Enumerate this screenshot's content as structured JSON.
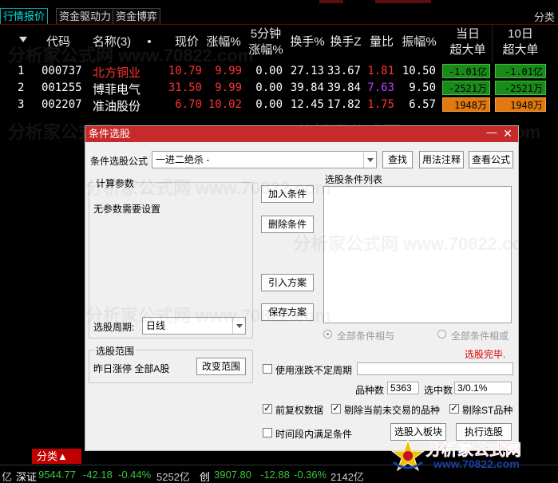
{
  "tabs": [
    "行情报价",
    "资金驱动力",
    "资金博弈"
  ],
  "top_right": "分类",
  "columns": {
    "code": "代码",
    "name": "名称(3)",
    "dot": "•",
    "price": "现价",
    "chg": "涨幅%",
    "chg5_1": "5分钟",
    "chg5_2": "涨幅%",
    "turnover": "换手%",
    "turnoverz": "换手Z",
    "volratio": "量比",
    "amplitude": "振幅%",
    "today1": "当日",
    "today2": "超大单",
    "ten1": "10日",
    "ten2": "超大单"
  },
  "rows": [
    {
      "idx": "1",
      "code": "000737",
      "name": "北方铜业",
      "price": "10.79",
      "chg": "9.99",
      "chg5": "0.00",
      "turnover": "27.13",
      "turnoverz": "33.67",
      "volratio": "1.81",
      "amplitude": "10.50",
      "today": "-1.01亿",
      "ten": "-1.01亿"
    },
    {
      "idx": "2",
      "code": "001255",
      "name": "博菲电气",
      "price": "31.50",
      "chg": "9.99",
      "chg5": "0.00",
      "turnover": "39.84",
      "turnoverz": "39.84",
      "volratio": "7.63",
      "amplitude": "9.50",
      "today": "-2521万",
      "ten": "-2521万"
    },
    {
      "idx": "3",
      "code": "002207",
      "name": "准油股份",
      "price": "6.70",
      "chg": "10.02",
      "chg5": "0.00",
      "turnover": "12.45",
      "turnoverz": "17.82",
      "volratio": "1.75",
      "amplitude": "6.57",
      "today": "1948万",
      "ten": "1948万"
    }
  ],
  "colors": {
    "red": "#ff3232",
    "green_box": "#1a8b1a",
    "orange_box": "#e07a10",
    "purple": "#c040ff",
    "title_bar": "#c72a2a"
  },
  "dialog": {
    "title": "条件选股",
    "formula_label": "条件选股公式",
    "formula_value": "一进二绝杀   -",
    "find_btn": "查找",
    "usage_btn": "用法注释",
    "view_btn": "查看公式",
    "calc_group": "计算参数",
    "no_params": "无参数需要设置",
    "add_btn": "加入条件",
    "del_btn": "删除条件",
    "import_btn": "引入方案",
    "save_btn": "保存方案",
    "list_label": "选股条件列表",
    "period_label": "选股周期:",
    "period_value": "日线",
    "radio_and": "全部条件相与",
    "radio_or": "全部条件相或",
    "done_msg": "选股完毕.",
    "range_group": "选股范围",
    "range_value": "昨日涨停 全部A股",
    "change_range_btn": "改变范围",
    "uncertain_label": "使用涨跌不定周期",
    "count_label": "品种数",
    "count_value": "5363",
    "selected_label": "选中数",
    "selected_value": "3/0.1%",
    "opt_prefq": "前复权数据",
    "opt_exclude_untraded": "剔除当前未交易的品种",
    "opt_exclude_st": "剔除ST品种",
    "opt_period_match": "时间段内满足条件",
    "to_block_btn": "选股入板块",
    "run_btn": "执行选股"
  },
  "bottom": {
    "fenlei": "分类▲",
    "left_frag": "亿",
    "index_name": "深证",
    "index_value": "9544.77",
    "index_chg": "-42.18",
    "index_pct": "-0.44%",
    "index_amt": "5252亿",
    "idx2_name": "创",
    "idx2_value": "3907.80",
    "idx2_chg": "-12.88",
    "idx2_pct": "-0.36%",
    "idx2_amt": "2142亿"
  },
  "logo": {
    "cn": "分析家公式网",
    "url": "www.70822.com"
  },
  "watermarks": [
    "分析家公式网 www.70822.com"
  ]
}
